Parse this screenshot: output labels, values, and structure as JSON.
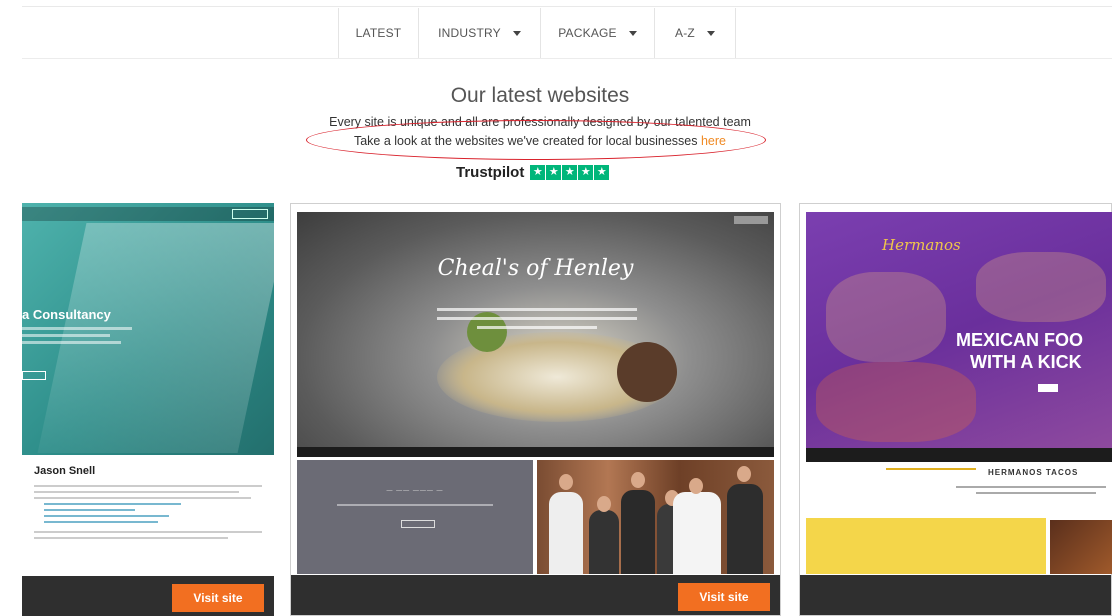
{
  "filters": [
    {
      "label": "LATEST",
      "has_dropdown": false
    },
    {
      "label": "INDUSTRY",
      "has_dropdown": true
    },
    {
      "label": "PACKAGE",
      "has_dropdown": true
    },
    {
      "label": "A-Z",
      "has_dropdown": true
    }
  ],
  "intro": {
    "title": "Our latest websites",
    "line1": "Every site is unique and all are professionally designed by our talented team",
    "line2_prefix": "Take a look at the websites we've created for local businesses ",
    "line2_link": "here",
    "annotation_color": "#d9232d"
  },
  "trustpilot": {
    "label": "Trustpilot",
    "stars": 5,
    "color": "#00b67a"
  },
  "cards": [
    {
      "heading": "a Consultancy",
      "body_name": "Jason Snell",
      "visit_label": "Visit site"
    },
    {
      "heading": "Cheal's of Henley",
      "visit_label": "Visit site"
    },
    {
      "logo": "Hermanos",
      "heading_line1": "MEXICAN FOO",
      "heading_line2": "WITH A KICK",
      "body_name": "HERMANOS TACOS"
    }
  ],
  "colors": {
    "accent_orange": "#f26f21",
    "card_footer": "#2f2f2f"
  }
}
